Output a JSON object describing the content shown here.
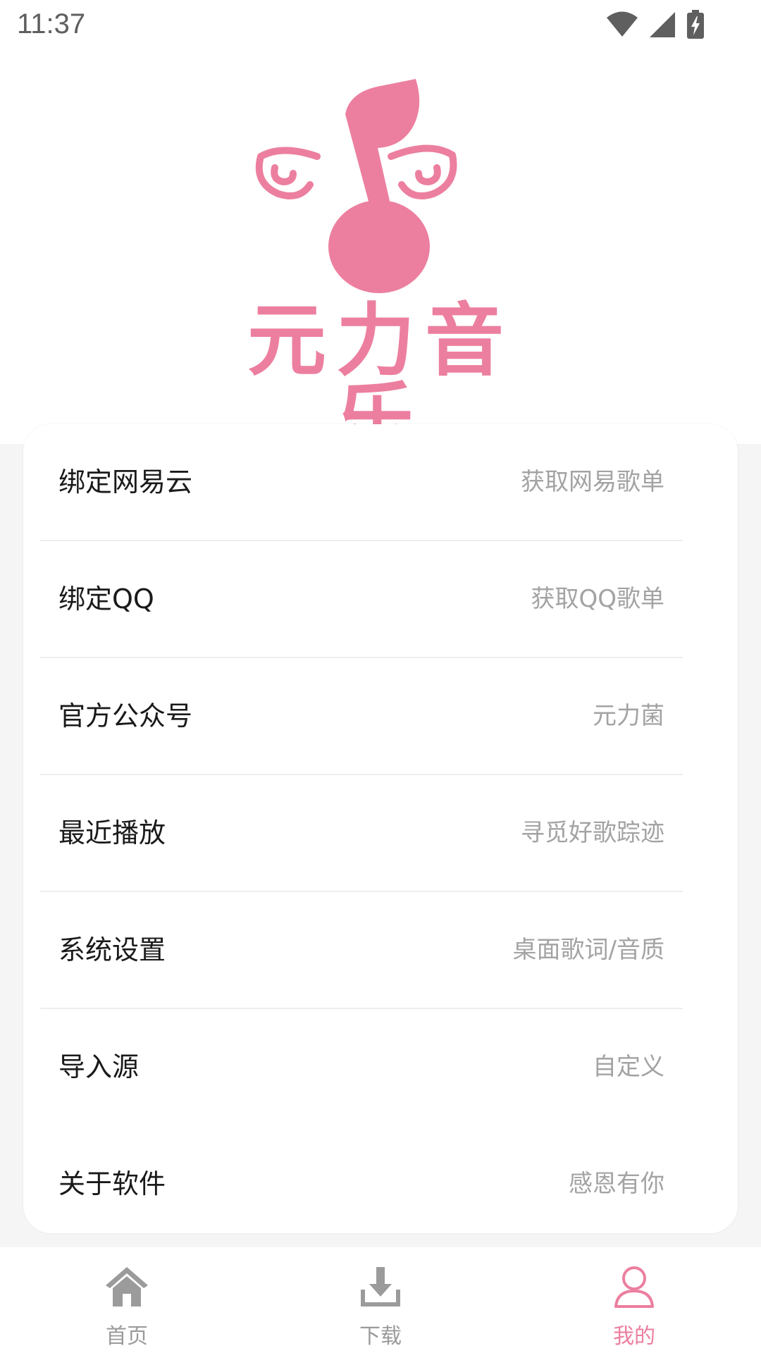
{
  "status_bar": {
    "time": "11:37",
    "icons": [
      "wifi-icon",
      "signal-icon",
      "battery-charging-icon"
    ]
  },
  "logo": {
    "wordmark": "元力音乐",
    "icon": "winged-music-note-icon",
    "color": "#ec7f9f"
  },
  "menu": {
    "items": [
      {
        "label": "绑定网易云",
        "value": "获取网易歌单"
      },
      {
        "label": "绑定QQ",
        "value": "获取QQ歌单"
      },
      {
        "label": "官方公众号",
        "value": "元力菌"
      },
      {
        "label": "最近播放",
        "value": "寻觅好歌踪迹"
      },
      {
        "label": "系统设置",
        "value": "桌面歌词/音质"
      },
      {
        "label": "导入源",
        "value": "自定义"
      },
      {
        "label": "关于软件",
        "value": "感恩有你"
      }
    ]
  },
  "bottom_nav": {
    "accent_color": "#ec7f9f",
    "inactive_color": "#9b9b9b",
    "active_tab": "我的",
    "tabs": [
      {
        "label": "首页",
        "icon": "home-icon"
      },
      {
        "label": "下载",
        "icon": "download-icon"
      },
      {
        "label": "我的",
        "icon": "user-icon"
      }
    ]
  }
}
